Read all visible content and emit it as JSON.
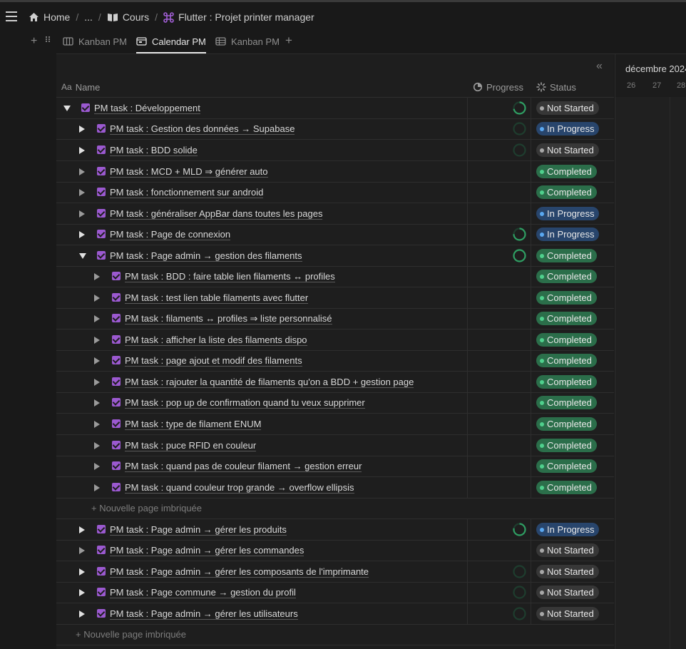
{
  "breadcrumb": {
    "home": "Home",
    "ellipsis": "...",
    "course": "Cours",
    "page": "Flutter : Projet printer manager"
  },
  "tabs": [
    {
      "label": "Kanban PM",
      "active": false,
      "icon": "board-icon"
    },
    {
      "label": "Calendar PM",
      "active": true,
      "icon": "calendar-icon"
    },
    {
      "label": "Kanban PM",
      "active": false,
      "icon": "table-icon"
    }
  ],
  "columns": {
    "name_prefix": "Aa",
    "name": "Name",
    "progress": "Progress",
    "status": "Status"
  },
  "calendar": {
    "month": "décembre 2024",
    "days": [
      "26",
      "27",
      "28"
    ]
  },
  "colors": {
    "completed": "#2b6e4a",
    "in_progress": "#28456c",
    "not_started": "#373737",
    "checkbox": "#9b59d0",
    "ring": "#2f9e63"
  },
  "rows": [
    {
      "title": "PM task : Développement",
      "status": "Not Started",
      "progress": 0.72
    },
    {
      "title": "PM task : Gestion des données → Supabase",
      "status": "In Progress",
      "progress": 0
    },
    {
      "title": "PM task : BDD solide",
      "status": "Not Started",
      "progress": 0
    },
    {
      "title": "PM task : MCD + MLD ⇒ générer auto",
      "status": "Completed"
    },
    {
      "title": "PM task : fonctionnement sur android",
      "status": "Completed"
    },
    {
      "title": "PM task : généraliser AppBar dans toutes les pages",
      "status": "In Progress"
    },
    {
      "title": "PM task : Page de connexion",
      "status": "In Progress",
      "progress": 0.75
    },
    {
      "title": "PM task : Page admin → gestion des filaments",
      "status": "Completed",
      "progress": 1.0
    },
    {
      "title": "PM task : BDD : faire table lien filaments ↔ profiles",
      "status": "Completed"
    },
    {
      "title": "PM task : test lien table filaments avec flutter",
      "status": "Completed"
    },
    {
      "title": "PM task : filaments ↔ profiles ⇒ liste personnalisé",
      "status": "Completed"
    },
    {
      "title": "PM task : afficher la liste des filaments dispo",
      "status": "Completed"
    },
    {
      "title": "PM task : page ajout et modif des filaments",
      "status": "Completed"
    },
    {
      "title": "PM task : rajouter la quantité de filaments qu'on a BDD + gestion page",
      "status": "Completed"
    },
    {
      "title": "PM task : pop up de confirmation quand tu veux supprimer",
      "status": "Completed"
    },
    {
      "title": "PM task : type de filament ENUM",
      "status": "Completed"
    },
    {
      "title": "PM task : puce RFID en couleur",
      "status": "Completed"
    },
    {
      "title": "PM task : quand pas de couleur filament → gestion erreur",
      "status": "Completed"
    },
    {
      "title": "PM task : quand couleur trop grande → overflow ellipsis",
      "status": "Completed"
    },
    {
      "new_page": "Nouvelle page imbriquée"
    },
    {
      "title": "PM task : Page admin → gérer les produits",
      "status": "In Progress",
      "progress": 0.78
    },
    {
      "title": "PM task : Page admin → gérer les commandes",
      "status": "Not Started"
    },
    {
      "title": "PM task : Page admin → gérer les composants de l'imprimante",
      "status": "Not Started",
      "progress": 0
    },
    {
      "title": "PM task : Page commune → gestion du profil",
      "status": "Not Started",
      "progress": 0
    },
    {
      "title": "PM task : Page admin → gérer les utilisateurs",
      "status": "Not Started",
      "progress": 0
    },
    {
      "new_page": "Nouvelle page imbriquée"
    }
  ]
}
